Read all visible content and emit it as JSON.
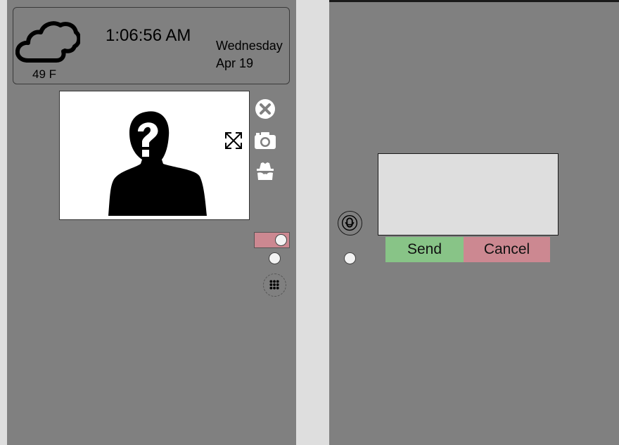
{
  "weather": {
    "temperature": "49 F",
    "icon": "cloud-icon"
  },
  "clock": {
    "time": "1:06:56 AM",
    "day": "Wednesday",
    "date": "Apr 19"
  },
  "video": {
    "placeholder_icon": "unknown-person-icon",
    "expand_icon": "expand-icon"
  },
  "controls": {
    "icons": [
      "close-icon",
      "camera-icon",
      "incognito-icon",
      "keypad-icon",
      "microphone-icon"
    ],
    "toggle_color": "#cc8891"
  },
  "message": {
    "value": "",
    "send_label": "Send",
    "cancel_label": "Cancel"
  },
  "colors": {
    "panel": "#808080",
    "background": "#dedede",
    "send": "#88c487",
    "cancel": "#cc8891"
  }
}
